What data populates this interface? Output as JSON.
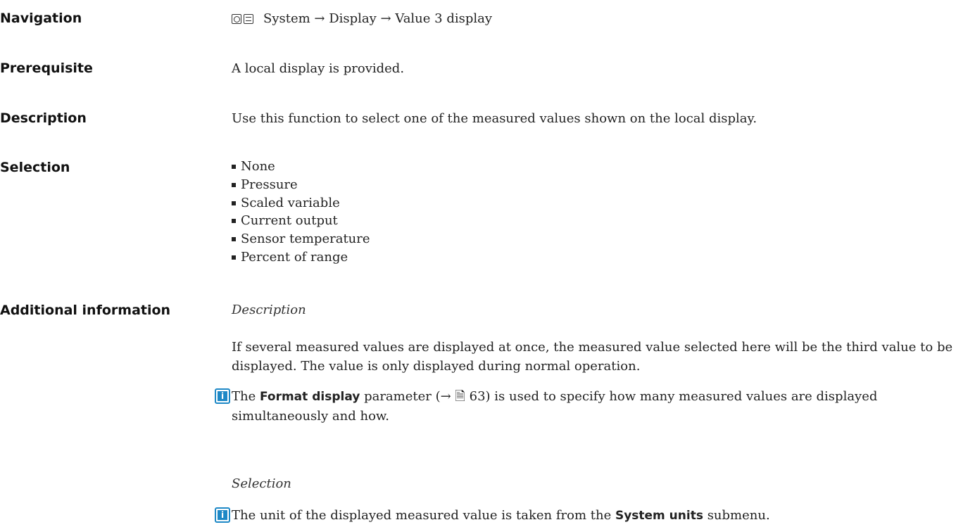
{
  "navigation": {
    "label": "Navigation",
    "icons": [
      "operating-tool-icon",
      "display-icon"
    ],
    "path": "System → Display → Value 3 display"
  },
  "prerequisite": {
    "label": "Prerequisite",
    "text": "A local display is provided."
  },
  "description": {
    "label": "Description",
    "text": "Use this function to select one of the measured values shown on the local display."
  },
  "selection": {
    "label": "Selection",
    "items": [
      "None",
      "Pressure",
      "Scaled variable",
      "Current output",
      "Sensor temperature",
      "Percent of range"
    ]
  },
  "additional": {
    "label": "Additional information",
    "desc_heading": "Description",
    "desc_text": "If several measured values are displayed at once, the measured value selected here will be the third value to be displayed. The value is only displayed during normal operation.",
    "note1": {
      "pre": "The ",
      "bold": "Format display",
      "mid": " parameter (→ ",
      "page_icon": "page-icon",
      "page": "63",
      "post": ") is used to specify how many measured values are displayed simultaneously and how."
    },
    "sel_heading": "Selection",
    "note2": {
      "pre": "The unit of the displayed measured value is taken from the ",
      "bold": "System units",
      "post": " submenu."
    }
  }
}
